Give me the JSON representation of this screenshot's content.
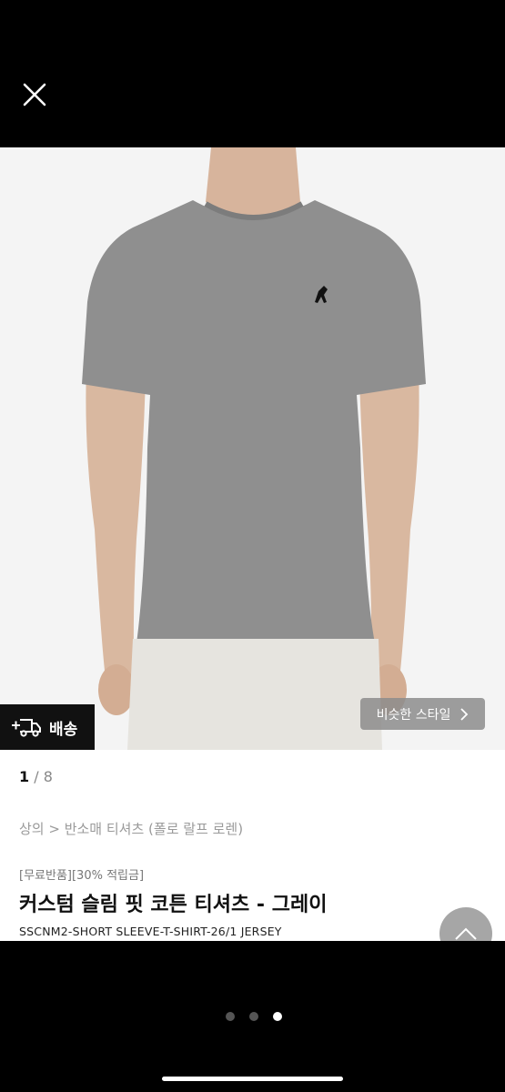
{
  "viewer": {
    "close_icon": "close-icon"
  },
  "badge": {
    "icon": "delivery-truck-icon",
    "label": "배송"
  },
  "similar_style": {
    "label": "비슷한 스타일",
    "icon": "chevron-right-icon"
  },
  "pager": {
    "current": "1",
    "separator": "/",
    "total": "8"
  },
  "product": {
    "breadcrumb": "상의 > 반소매 티셔츠 (폴로 랄프 로렌)",
    "tags": "[무료반품][30% 적립금]",
    "title": "커스텀 슬림 핏 코튼 티셔츠 - 그레이",
    "sku": "SSCNM2-SHORT SLEEVE-T-SHIRT-26/1 JERSEY"
  },
  "scroll_top_icon": "chevron-up-icon",
  "carousel_dots": {
    "count": 3,
    "active_index": 2
  },
  "colors": {
    "shirt": "#8f8f8f",
    "background": "#f4f4f4",
    "chrome": "#000000"
  }
}
